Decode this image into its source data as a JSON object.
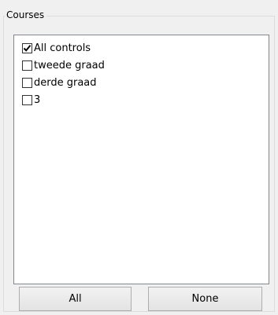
{
  "groupbox": {
    "title": "Courses"
  },
  "courses_list": {
    "items": [
      {
        "label": "All controls",
        "checked": true
      },
      {
        "label": "tweede graad",
        "checked": false
      },
      {
        "label": "derde graad",
        "checked": false
      },
      {
        "label": "3",
        "checked": false
      }
    ]
  },
  "buttons": {
    "all_label": "All",
    "none_label": "None"
  }
}
